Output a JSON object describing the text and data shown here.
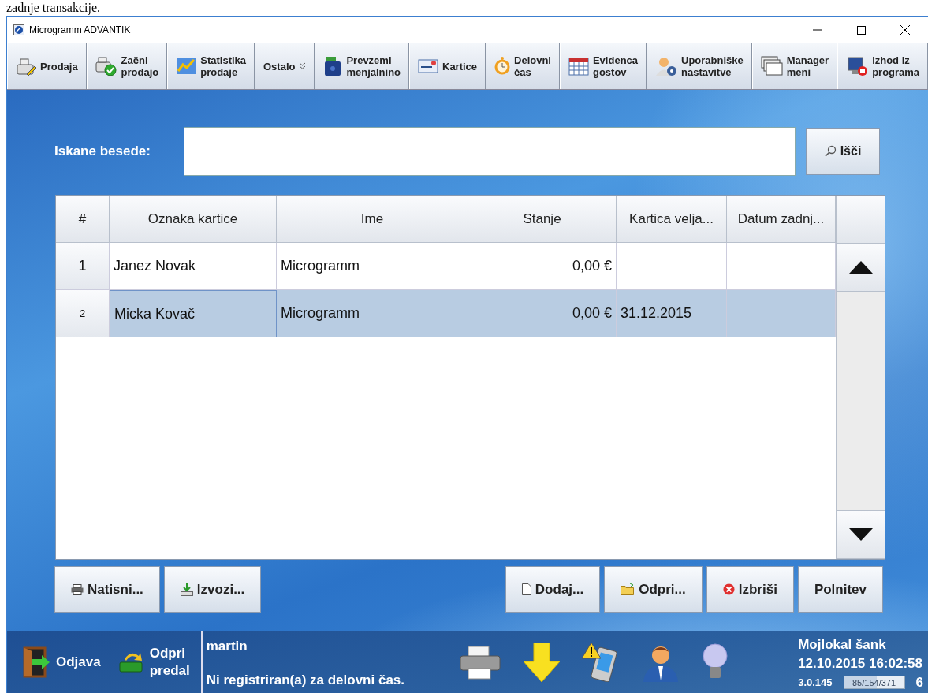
{
  "background_text": "zadnje transakcije.",
  "window": {
    "title": "Microgramm ADVANTIK"
  },
  "toolbar": [
    {
      "kind": "button",
      "lines": [
        "Prodaja"
      ]
    },
    {
      "kind": "button",
      "lines": [
        "Začni",
        "prodajo"
      ]
    },
    {
      "kind": "button",
      "lines": [
        "Statistika",
        "prodaje"
      ]
    },
    {
      "kind": "menu",
      "lines": [
        "Ostalo"
      ]
    },
    {
      "kind": "button",
      "lines": [
        "Prevzemi",
        "menjalnino"
      ]
    },
    {
      "kind": "button",
      "lines": [
        "Kartice"
      ]
    },
    {
      "kind": "button",
      "lines": [
        "Delovni",
        "čas"
      ]
    },
    {
      "kind": "button",
      "lines": [
        "Evidenca",
        "gostov"
      ]
    },
    {
      "kind": "button",
      "lines": [
        "Uporabniške",
        "nastavitve"
      ]
    },
    {
      "kind": "button",
      "lines": [
        "Manager",
        "meni"
      ]
    },
    {
      "kind": "button",
      "lines": [
        "Izhod iz",
        "programa"
      ]
    }
  ],
  "search": {
    "label": "Iskane besede:",
    "button": "Išči"
  },
  "table": {
    "columns": [
      "#",
      "Oznaka kartice",
      "Ime",
      "Stanje",
      "Kartica velja...",
      "Datum zadnj..."
    ],
    "rows": [
      {
        "selected": false,
        "cells": [
          "1",
          "Janez Novak",
          "Microgramm",
          "0,00 €",
          "",
          ""
        ]
      },
      {
        "selected": true,
        "cells": [
          "2",
          "Micka Kovač",
          "Microgramm",
          "0,00 €",
          "31.12.2015",
          ""
        ]
      }
    ]
  },
  "actions_left": [
    "Natisni...",
    "Izvozi..."
  ],
  "actions_right": [
    "Dodaj...",
    "Odpri...",
    "Izbriši",
    "Polnitev"
  ],
  "status_bar": {
    "logout": "Odjava",
    "drawer": [
      "Odpri",
      "predal"
    ],
    "user": "martin",
    "message": "Ni registriran(a) za delovni čas.",
    "location": "Mojlokal šank",
    "datetime": "12.10.2015 16:02:58",
    "version": "3.0.145",
    "memory": {
      "text": "85/154/371",
      "level": 0.55
    },
    "column_cut": "6"
  }
}
